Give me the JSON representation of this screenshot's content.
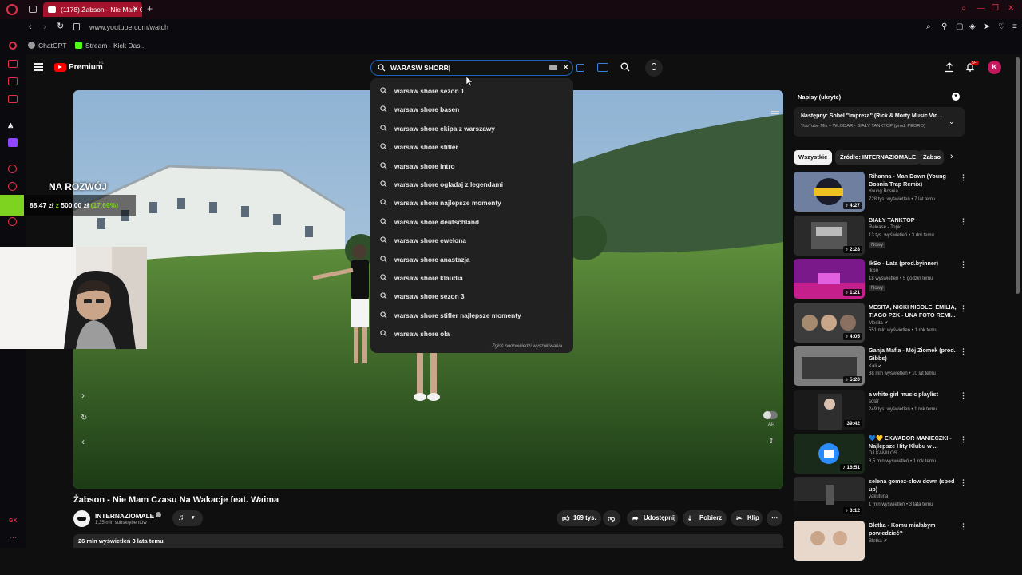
{
  "browser": {
    "tab_title": "(1178) Żabson - Nie Mam C",
    "url": "www.youtube.com/watch",
    "bookmarks": [
      "ChatGPT",
      "Stream - Kick Das..."
    ],
    "accent": "#a3142c"
  },
  "header": {
    "logo_text": "Premium",
    "logo_region": "PL",
    "notif_count": "9+",
    "avatar_letter": "K"
  },
  "search": {
    "value": "WARASW SHORR|",
    "suggestions": [
      "warsaw shore sezon 1",
      "warsaw shore basen",
      "warsaw shore ekipa z warszawy",
      "warsaw shore stifler",
      "warsaw shore intro",
      "warsaw shore ogladaj z legendami",
      "warsaw shore najlepsze momenty",
      "warsaw shore deutschland",
      "warsaw shore ewelona",
      "warsaw shore anastazja",
      "warsaw shore klaudia",
      "warsaw shore sezon 3",
      "warsaw shore stifler najlepsze momenty",
      "warsaw shore ola"
    ],
    "report_text": "Zgłoś podpowiedzi wyszukiwania"
  },
  "stream_overlay": {
    "goal_title": "NA ROZWÓJ",
    "goal_current": "88,47 zł",
    "goal_sep": "z",
    "goal_target": "500,00 zł",
    "goal_percent": "(17.69%)",
    "goal_fraction": 0.1769,
    "accent": "#7ed321"
  },
  "video": {
    "title": "Żabson - Nie Mam Czasu Na Wakacje feat. Waima",
    "channel": "INTERNAZIOMALE",
    "subscribers": "1,35 mln subskrybentów",
    "likes": "169 tys.",
    "share_label": "Udostępnij",
    "download_label": "Pobierz",
    "clip_label": "Klip",
    "views_date": "26 mln wyświetleń  3 lata temu",
    "autoplay_label": "AP"
  },
  "sidebar": {
    "captions_label": "Napisy (ukryte)",
    "next_title": "Następny: Sobel \"Impreza\" (Rick & Morty Music Vid...",
    "next_sub": "YouTube Mix – WŁODAR - BIAŁY TANKTOP (prod. PEDRO)",
    "chips": [
      "Wszystkie",
      "Źródło: INTERNAZIOMALE",
      "Żabso"
    ],
    "recommendations": [
      {
        "title": "Rihanna - Man Down (Young Bosnia Trap Remix)",
        "channel": "Young Bosnia",
        "meta": "728 tys. wyświetleń • 7 lat temu",
        "duration": "♪ 4:27",
        "thumb": "young-bosnia",
        "badge": ""
      },
      {
        "title": "BIAŁY TANKTOP",
        "channel": "Release - Topic",
        "meta": "13 tys. wyświetleń • 3 dni temu",
        "duration": "♪ 2:28",
        "thumb": "tanktop",
        "badge": "Nowy"
      },
      {
        "title": "IkSo - Lata (prod.byinner)",
        "channel": "IkSo",
        "meta": "18 wyświetleń • 5 godzin temu",
        "duration": "♪ 1:21",
        "thumb": "lata",
        "badge": "Nowy"
      },
      {
        "title": "MESITA, NICKI NICOLE, EMILIA, TIAGO PZK - UNA FOTO REMI...",
        "channel": "Mesita ✔",
        "meta": "551 mln wyświetleń • 1 rok temu",
        "duration": "♪ 4:05",
        "thumb": "mesita",
        "badge": ""
      },
      {
        "title": "Ganja Mafia - Mój Ziomek (prod. Gibbs)",
        "channel": "Kali ✔",
        "meta": "88 mln wyświetleń • 10 lat temu",
        "duration": "♪ 5:20",
        "thumb": "ganja",
        "badge": ""
      },
      {
        "title": "a white girl music playlist",
        "channel": "solar",
        "meta": "249 tys. wyświetleń • 1 rok temu",
        "duration": "39:42",
        "thumb": "whitegirl",
        "badge": ""
      },
      {
        "title": "💙💛 EKWADOR MANIECZKI - Najlepsze Hity Klubu w ...",
        "channel": "DJ KAMILOS",
        "meta": "8,5 mln wyświetleń • 1 rok temu",
        "duration": "♪ 16:51",
        "thumb": "ekwador",
        "badge": ""
      },
      {
        "title": "selena gomez-slow down (sped up)",
        "channel": "yakutuna",
        "meta": "1 mln wyświetleń • 3 lata temu",
        "duration": "♪ 3:12",
        "thumb": "selena",
        "badge": ""
      },
      {
        "title": "Bletka - Komu miałabym powiedzieć?",
        "channel": "Bletka ✔",
        "meta": "",
        "duration": "",
        "thumb": "bletka",
        "badge": ""
      }
    ]
  },
  "left_rail_icons": [
    "opera-icon",
    "home-icon",
    "box-icon",
    "messenger-icon",
    "mail-icon",
    "vpn-icon",
    "twitch-icon",
    "player-icon",
    "history-icon",
    "settings-icon"
  ],
  "gx_label": "GX"
}
